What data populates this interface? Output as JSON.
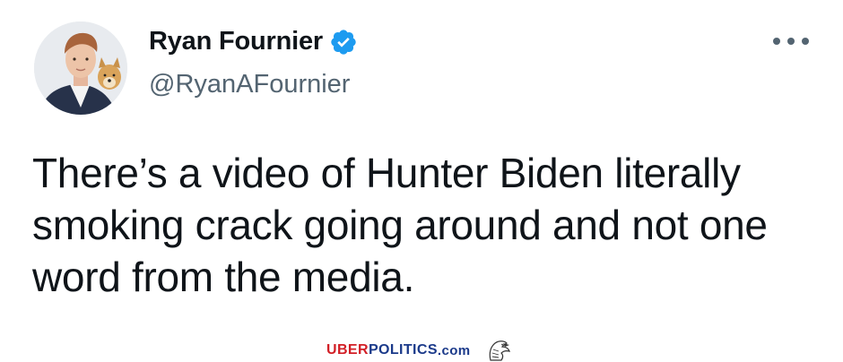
{
  "tweet": {
    "author": {
      "display_name": "Ryan Fournier",
      "handle": "@RyanAFournier",
      "verified": true,
      "avatar_icon": "profile-photo-with-dog"
    },
    "more_icon": "more-horizontal-icon",
    "text": "There’s a video of Hunter Biden literally smoking crack going around and not one word from the media."
  },
  "watermark": {
    "part1": "UBER",
    "part2": "POLITICS",
    "part3": ".com",
    "logo_icon": "eagle-icon"
  },
  "colors": {
    "text_primary": "#0f1419",
    "text_secondary": "#536471",
    "verified_blue": "#1d9bf0",
    "watermark_red": "#d21f26",
    "watermark_blue": "#1b3a8a"
  }
}
